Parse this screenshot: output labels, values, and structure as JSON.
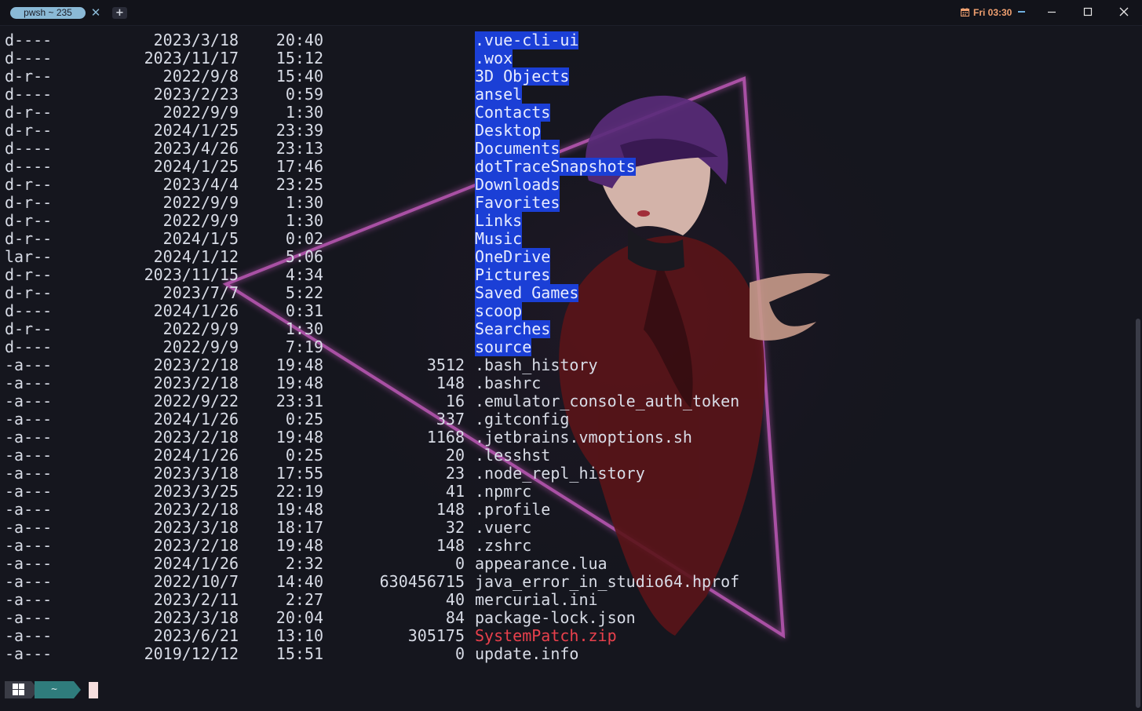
{
  "titlebar": {
    "tab_title": "pwsh ~ 235",
    "clock": "Fri 03:30"
  },
  "prompt": {
    "path": "~"
  },
  "listing": [
    {
      "mode": "d----",
      "date": "2023/3/18",
      "time": "20:40",
      "length": "",
      "name": ".vue-cli-ui",
      "type": "dir"
    },
    {
      "mode": "d----",
      "date": "2023/11/17",
      "time": "15:12",
      "length": "",
      "name": ".wox",
      "type": "dir"
    },
    {
      "mode": "d-r--",
      "date": "2022/9/8",
      "time": "15:40",
      "length": "",
      "name": "3D Objects",
      "type": "dir"
    },
    {
      "mode": "d----",
      "date": "2023/2/23",
      "time": "0:59",
      "length": "",
      "name": "ansel",
      "type": "dir"
    },
    {
      "mode": "d-r--",
      "date": "2022/9/9",
      "time": "1:30",
      "length": "",
      "name": "Contacts",
      "type": "dir"
    },
    {
      "mode": "d-r--",
      "date": "2024/1/25",
      "time": "23:39",
      "length": "",
      "name": "Desktop",
      "type": "dir"
    },
    {
      "mode": "d----",
      "date": "2023/4/26",
      "time": "23:13",
      "length": "",
      "name": "Documents",
      "type": "dir"
    },
    {
      "mode": "d----",
      "date": "2024/1/25",
      "time": "17:46",
      "length": "",
      "name": "dotTraceSnapshots",
      "type": "dir"
    },
    {
      "mode": "d-r--",
      "date": "2023/4/4",
      "time": "23:25",
      "length": "",
      "name": "Downloads",
      "type": "dir"
    },
    {
      "mode": "d-r--",
      "date": "2022/9/9",
      "time": "1:30",
      "length": "",
      "name": "Favorites",
      "type": "dir"
    },
    {
      "mode": "d-r--",
      "date": "2022/9/9",
      "time": "1:30",
      "length": "",
      "name": "Links",
      "type": "dir"
    },
    {
      "mode": "d-r--",
      "date": "2024/1/5",
      "time": "0:02",
      "length": "",
      "name": "Music",
      "type": "dir"
    },
    {
      "mode": "lar--",
      "date": "2024/1/12",
      "time": "5:06",
      "length": "",
      "name": "OneDrive",
      "type": "dir"
    },
    {
      "mode": "d-r--",
      "date": "2023/11/15",
      "time": "4:34",
      "length": "",
      "name": "Pictures",
      "type": "dir"
    },
    {
      "mode": "d-r--",
      "date": "2023/7/7",
      "time": "5:22",
      "length": "",
      "name": "Saved Games",
      "type": "dir"
    },
    {
      "mode": "d----",
      "date": "2024/1/26",
      "time": "0:31",
      "length": "",
      "name": "scoop",
      "type": "dir"
    },
    {
      "mode": "d-r--",
      "date": "2022/9/9",
      "time": "1:30",
      "length": "",
      "name": "Searches",
      "type": "dir"
    },
    {
      "mode": "d----",
      "date": "2022/9/9",
      "time": "7:19",
      "length": "",
      "name": "source",
      "type": "dir"
    },
    {
      "mode": "-a---",
      "date": "2023/2/18",
      "time": "19:48",
      "length": "3512",
      "name": ".bash_history",
      "type": "file"
    },
    {
      "mode": "-a---",
      "date": "2023/2/18",
      "time": "19:48",
      "length": "148",
      "name": ".bashrc",
      "type": "file"
    },
    {
      "mode": "-a---",
      "date": "2022/9/22",
      "time": "23:31",
      "length": "16",
      "name": ".emulator_console_auth_token",
      "type": "file"
    },
    {
      "mode": "-a---",
      "date": "2024/1/26",
      "time": "0:25",
      "length": "337",
      "name": ".gitconfig",
      "type": "file"
    },
    {
      "mode": "-a---",
      "date": "2023/2/18",
      "time": "19:48",
      "length": "1168",
      "name": ".jetbrains.vmoptions.sh",
      "type": "file"
    },
    {
      "mode": "-a---",
      "date": "2024/1/26",
      "time": "0:25",
      "length": "20",
      "name": ".lesshst",
      "type": "file"
    },
    {
      "mode": "-a---",
      "date": "2023/3/18",
      "time": "17:55",
      "length": "23",
      "name": ".node_repl_history",
      "type": "file"
    },
    {
      "mode": "-a---",
      "date": "2023/3/25",
      "time": "22:19",
      "length": "41",
      "name": ".npmrc",
      "type": "file"
    },
    {
      "mode": "-a---",
      "date": "2023/2/18",
      "time": "19:48",
      "length": "148",
      "name": ".profile",
      "type": "file"
    },
    {
      "mode": "-a---",
      "date": "2023/3/18",
      "time": "18:17",
      "length": "32",
      "name": ".vuerc",
      "type": "file"
    },
    {
      "mode": "-a---",
      "date": "2023/2/18",
      "time": "19:48",
      "length": "148",
      "name": ".zshrc",
      "type": "file"
    },
    {
      "mode": "-a---",
      "date": "2024/1/26",
      "time": "2:32",
      "length": "0",
      "name": "appearance.lua",
      "type": "file"
    },
    {
      "mode": "-a---",
      "date": "2022/10/7",
      "time": "14:40",
      "length": "630456715",
      "name": "java_error_in_studio64.hprof",
      "type": "file"
    },
    {
      "mode": "-a---",
      "date": "2023/2/11",
      "time": "2:27",
      "length": "40",
      "name": "mercurial.ini",
      "type": "file"
    },
    {
      "mode": "-a---",
      "date": "2023/3/18",
      "time": "20:04",
      "length": "84",
      "name": "package-lock.json",
      "type": "file"
    },
    {
      "mode": "-a---",
      "date": "2023/6/21",
      "time": "13:10",
      "length": "305175",
      "name": "SystemPatch.zip",
      "type": "archive"
    },
    {
      "mode": "-a---",
      "date": "2019/12/12",
      "time": "15:51",
      "length": "0",
      "name": "update.info",
      "type": "file"
    }
  ],
  "colors": {
    "background": "#15161e",
    "text": "#d8dce6",
    "dir_highlight": "#1b3fd6",
    "archive": "#e8404c",
    "tab": "#8ab9d6",
    "clock": "#f0a070",
    "prompt_path_segment": "#2f7c7c",
    "cursor": "#f5dede"
  },
  "icons": {
    "tab_close": "close-icon",
    "new_tab": "plus-icon",
    "clock": "calendar-icon",
    "minimize": "minimize-icon",
    "maximize": "maximize-icon",
    "close": "close-icon",
    "prompt_os": "windows-logo-icon"
  }
}
